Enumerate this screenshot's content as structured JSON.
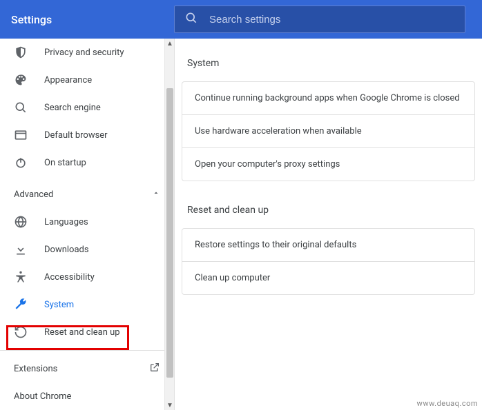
{
  "header": {
    "title": "Settings",
    "search_placeholder": "Search settings"
  },
  "sidebar": {
    "basic": [
      {
        "id": "privacy",
        "label": "Privacy and security",
        "icon": "shield-icon"
      },
      {
        "id": "appearance",
        "label": "Appearance",
        "icon": "palette-icon"
      },
      {
        "id": "search",
        "label": "Search engine",
        "icon": "search-icon"
      },
      {
        "id": "default",
        "label": "Default browser",
        "icon": "browser-icon"
      },
      {
        "id": "startup",
        "label": "On startup",
        "icon": "power-icon"
      }
    ],
    "advanced_label": "Advanced",
    "advanced": [
      {
        "id": "languages",
        "label": "Languages",
        "icon": "globe-icon"
      },
      {
        "id": "downloads",
        "label": "Downloads",
        "icon": "download-icon"
      },
      {
        "id": "accessibility",
        "label": "Accessibility",
        "icon": "accessibility-icon"
      },
      {
        "id": "system",
        "label": "System",
        "icon": "wrench-icon",
        "active": true
      },
      {
        "id": "reset",
        "label": "Reset and clean up",
        "icon": "restore-icon"
      }
    ],
    "footer": [
      {
        "id": "extensions",
        "label": "Extensions",
        "external": true
      },
      {
        "id": "about",
        "label": "About Chrome"
      }
    ]
  },
  "main": {
    "groups": [
      {
        "title": "System",
        "rows": [
          "Continue running background apps when Google Chrome is closed",
          "Use hardware acceleration when available",
          "Open your computer's proxy settings"
        ]
      },
      {
        "title": "Reset and clean up",
        "rows": [
          "Restore settings to their original defaults",
          "Clean up computer"
        ]
      }
    ]
  },
  "watermark": "www.deuaq.com"
}
